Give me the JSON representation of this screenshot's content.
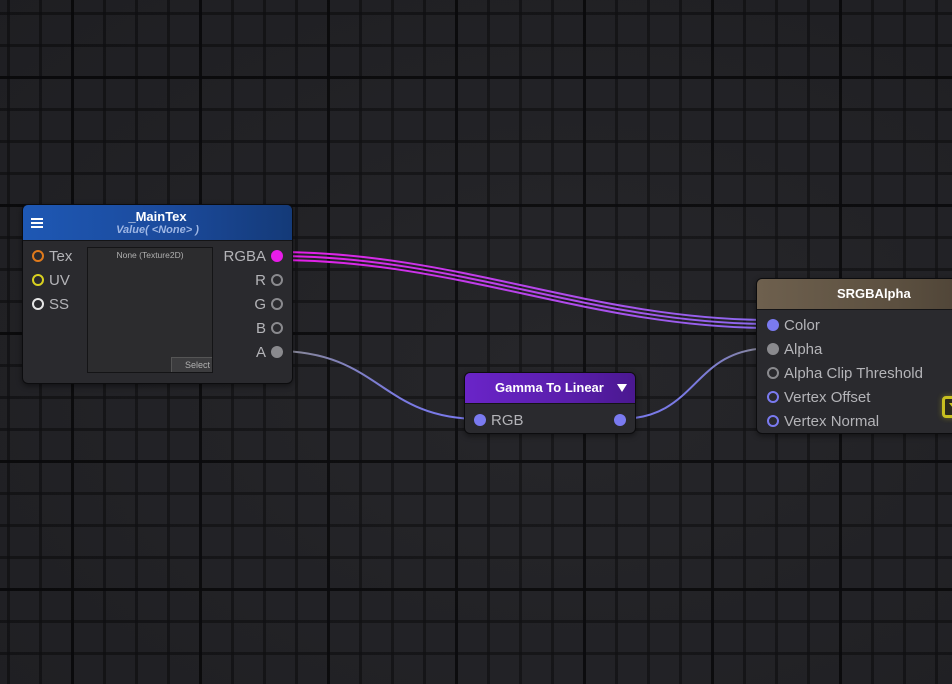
{
  "colors": {
    "background": "#212125",
    "wire_rgba_start": "#e81ce8",
    "wire_rgba_end": "#8a6cf0",
    "wire_float": "#7a7ae0",
    "wire_gray": "#8a8a8e",
    "port_orange": "#e07a1c",
    "port_yellow": "#d8d020",
    "port_white": "#e6e6e6",
    "port_magenta": "#e81ce8",
    "port_gray": "#8a8a8e",
    "port_blue": "#7a7af0"
  },
  "nodes": {
    "maintex": {
      "title": "_MainTex",
      "subtitle": "Value( <None> )",
      "menu_icon": "hamburger-icon",
      "inputs": [
        {
          "label": "Tex",
          "color": "#e07a1c"
        },
        {
          "label": "UV",
          "color": "#d8d020"
        },
        {
          "label": "SS",
          "color": "#e6e6e6"
        }
      ],
      "outputs": [
        {
          "label": "RGBA",
          "color": "#e81ce8",
          "connected": true
        },
        {
          "label": "R",
          "color": "#8a8a8e",
          "connected": false
        },
        {
          "label": "G",
          "color": "#8a8a8e",
          "connected": false
        },
        {
          "label": "B",
          "color": "#8a8a8e",
          "connected": false
        },
        {
          "label": "A",
          "color": "#8a8a8e",
          "connected": true
        }
      ],
      "preview_label": "None (Texture2D)",
      "select_label": "Select"
    },
    "gamma": {
      "title": "Gamma To Linear",
      "dropdown_icon": "triangle-down-icon",
      "input_label": "RGB",
      "input_color": "#7a7af0",
      "output_color": "#7a7af0"
    },
    "srgb": {
      "title": "SRGBAlpha",
      "inputs": [
        {
          "label": "Color",
          "color": "#7a7af0",
          "connected": true
        },
        {
          "label": "Alpha",
          "color": "#8a8a8e",
          "connected": true
        },
        {
          "label": "Alpha Clip Threshold",
          "color": "#8a8a8e",
          "connected": false
        },
        {
          "label": "Vertex Offset",
          "color": "#7a7af0",
          "connected": false
        },
        {
          "label": "Vertex Normal",
          "color": "#7a7af0",
          "connected": false
        }
      ]
    }
  }
}
